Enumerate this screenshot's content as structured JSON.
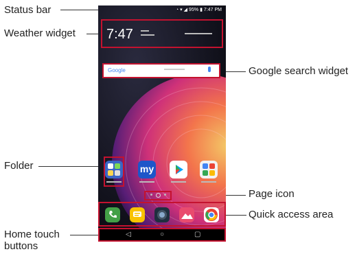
{
  "callouts": {
    "status_bar": "Status bar",
    "weather_widget": "Weather widget",
    "google_search_widget": "Google search widget",
    "folder": "Folder",
    "page_icon": "Page icon",
    "quick_access_area": "Quick access area",
    "home_touch_buttons_1": "Home touch",
    "home_touch_buttons_2": "buttons"
  },
  "phone": {
    "status": {
      "battery": "95%",
      "time": "7:47 PM"
    },
    "weather": {
      "time": "7:47"
    },
    "search": {
      "brand": "Google"
    },
    "apps": [
      {
        "name": "folder-app-icon",
        "color": "#3a66c6"
      },
      {
        "name": "my-app-icon",
        "label": "my",
        "color": "#1e56c9"
      },
      {
        "name": "play-store-icon",
        "color": "#ffffff"
      },
      {
        "name": "google-folder-icon",
        "color": "#f2f2f2"
      }
    ],
    "dock": [
      {
        "name": "phone-icon",
        "color": "#43a047"
      },
      {
        "name": "messages-icon",
        "color": "#f9c300"
      },
      {
        "name": "camera-icon",
        "color": "#1f2f3f"
      },
      {
        "name": "gallery-icon",
        "color": "#e94b6e"
      },
      {
        "name": "chrome-icon",
        "color": "#ffffff"
      }
    ],
    "accent_color": "#c4122f"
  }
}
